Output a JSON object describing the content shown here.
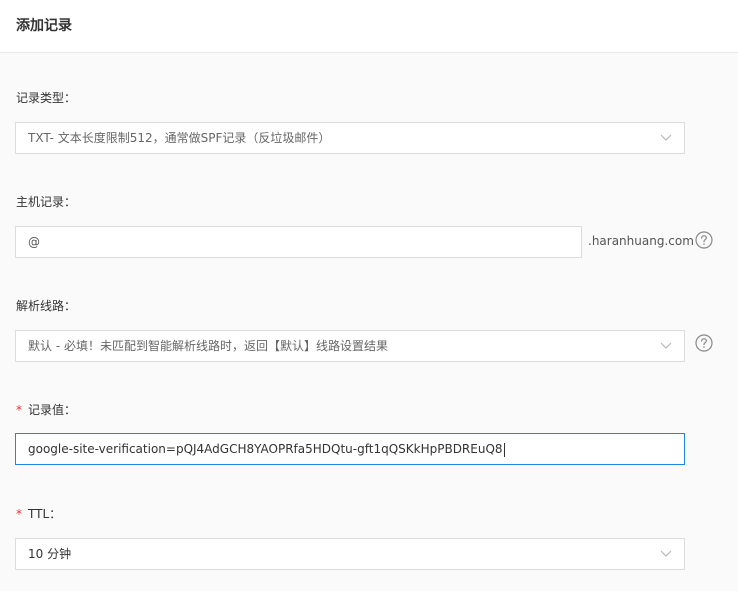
{
  "header": {
    "title": "添加记录"
  },
  "form": {
    "record_type": {
      "label": "记录类型：",
      "value": "TXT- 文本长度限制512，通常做SPF记录（反垃圾邮件）"
    },
    "host": {
      "label": "主机记录：",
      "value": "@",
      "suffix": ".haranhuang.com"
    },
    "line": {
      "label": "解析线路：",
      "value": "默认 - 必填！未匹配到智能解析线路时，返回【默认】线路设置结果"
    },
    "record_value": {
      "required_mark": "*",
      "label": "记录值：",
      "value": "google-site-verification=pQJ4AdGCH8YAOPRfa5HDQtu-gft1qQSKkHpPBDREuQ8"
    },
    "ttl": {
      "required_mark": "*",
      "label": "TTL：",
      "value": "10 分钟"
    }
  },
  "icons": {
    "dropdown": "chevron-down-icon",
    "help": "question-circle-icon"
  },
  "colors": {
    "focus_border": "#1e88e5",
    "required": "#e5342c"
  }
}
